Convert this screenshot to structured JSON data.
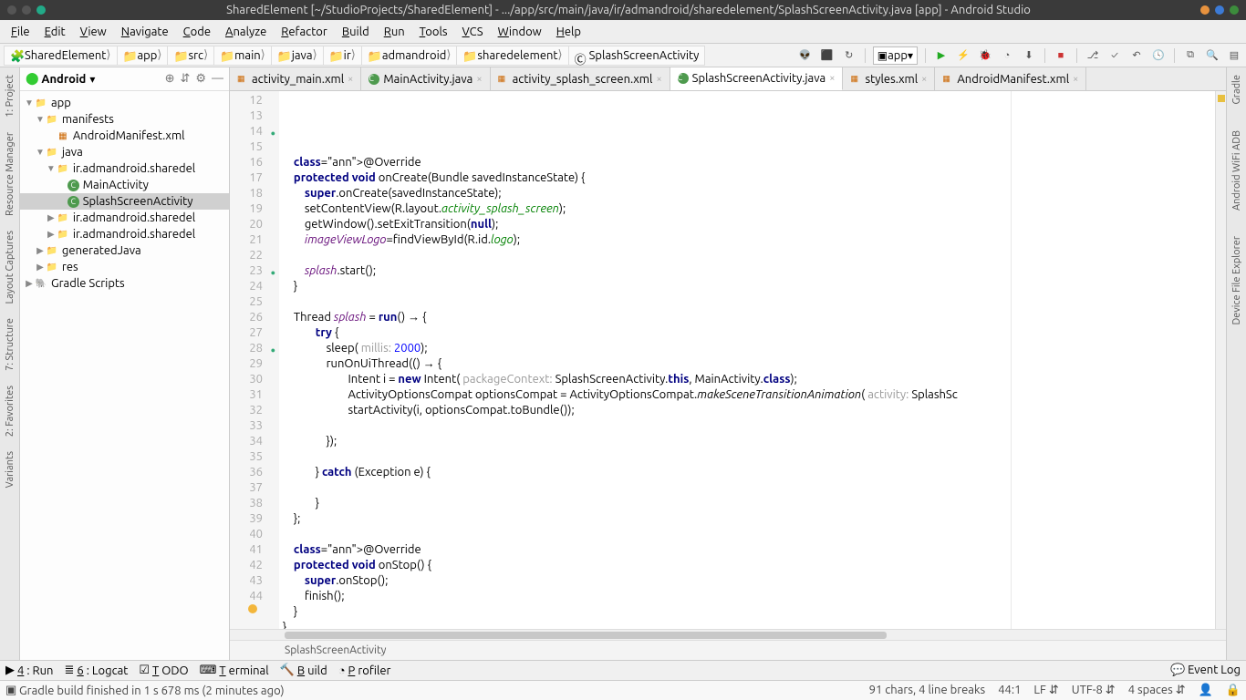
{
  "title": "SharedElement [~/StudioProjects/SharedElement] - .../app/src/main/java/ir/admandroid/sharedelement/SplashScreenActivity.java [app] - Android Studio",
  "menu": [
    "File",
    "Edit",
    "View",
    "Navigate",
    "Code",
    "Analyze",
    "Refactor",
    "Build",
    "Run",
    "Tools",
    "VCS",
    "Window",
    "Help"
  ],
  "breadcrumbs": [
    "SharedElement",
    "app",
    "src",
    "main",
    "java",
    "ir",
    "admandroid",
    "sharedelement",
    "SplashScreenActivity"
  ],
  "nav": {
    "app_combo": "app"
  },
  "project": {
    "view": "Android",
    "tree": [
      {
        "d": 0,
        "t": "app",
        "exp": true,
        "icon": "mod"
      },
      {
        "d": 1,
        "t": "manifests",
        "exp": true,
        "icon": "dir"
      },
      {
        "d": 2,
        "t": "AndroidManifest.xml",
        "icon": "xml"
      },
      {
        "d": 1,
        "t": "java",
        "exp": true,
        "icon": "dir"
      },
      {
        "d": 2,
        "t": "ir.admandroid.sharedelement",
        "exp": true,
        "icon": "pkg",
        "trunc": true
      },
      {
        "d": 3,
        "t": "MainActivity",
        "icon": "cls"
      },
      {
        "d": 3,
        "t": "SplashScreenActivity",
        "icon": "cls",
        "sel": true,
        "trunc": true
      },
      {
        "d": 2,
        "t": "ir.admandroid.sharedelement",
        "icon": "pkg",
        "trunc": true,
        "col": true
      },
      {
        "d": 2,
        "t": "ir.admandroid.sharedelement",
        "icon": "pkg",
        "trunc": true,
        "col": true
      },
      {
        "d": 1,
        "t": "generatedJava",
        "icon": "dir",
        "col": true
      },
      {
        "d": 1,
        "t": "res",
        "icon": "dir",
        "col": true
      },
      {
        "d": 0,
        "t": "Gradle Scripts",
        "icon": "gradle",
        "col": true
      }
    ]
  },
  "tabs": [
    {
      "label": "activity_main.xml",
      "icon": "xml"
    },
    {
      "label": "MainActivity.java",
      "icon": "cls"
    },
    {
      "label": "activity_splash_screen.xml",
      "icon": "xml"
    },
    {
      "label": "SplashScreenActivity.java",
      "icon": "cls",
      "active": true
    },
    {
      "label": "styles.xml",
      "icon": "xml"
    },
    {
      "label": "AndroidManifest.xml",
      "icon": "xml"
    }
  ],
  "code": {
    "start": 12,
    "lines": [
      "",
      "    @Override",
      "    protected void onCreate(Bundle savedInstanceState) {",
      "        super.onCreate(savedInstanceState);",
      "        setContentView(R.layout.activity_splash_screen);",
      "        getWindow().setExitTransition(null);",
      "        imageViewLogo=findViewById(R.id.logo);",
      "",
      "        splash.start();",
      "    }",
      "",
      "    Thread splash = run() → {",
      "            try {",
      "                sleep( millis: 2000);",
      "                runOnUiThread(() → {",
      "                        Intent i = new Intent( packageContext: SplashScreenActivity.this, MainActivity.class);",
      "                        ActivityOptionsCompat optionsCompat = ActivityOptionsCompat.makeSceneTransitionAnimation( activity: SplashSc",
      "                        startActivity(i, optionsCompat.toBundle());",
      "",
      "                });",
      "",
      "            } catch (Exception e) {",
      "",
      "            }",
      "    };",
      "",
      "    @Override",
      "    protected void onStop() {",
      "        super.onStop();",
      "        finish();",
      "    }",
      "}",
      ""
    ],
    "selected_from": 44,
    "selected_to": 48
  },
  "crumb": "SplashScreenActivity",
  "bottom": [
    " 4: Run",
    " 6: Logcat",
    "TODO",
    "Terminal",
    "Build",
    "Profiler"
  ],
  "event_log": "Event Log",
  "status": {
    "msg": "Gradle build finished in 1 s 678 ms (2 minutes ago)",
    "chars": "91 chars, 4 line breaks",
    "pos": "44:1",
    "le": "LF",
    "enc": "UTF-8",
    "ind": "4 spaces"
  },
  "left_rail": [
    "1: Project",
    "Resource Manager",
    "Layout Captures",
    "7: Structure",
    "2: Favorites",
    "Variants"
  ],
  "right_rail": [
    "Gradle",
    "Android WiFi ADB",
    "Device File Explorer"
  ]
}
